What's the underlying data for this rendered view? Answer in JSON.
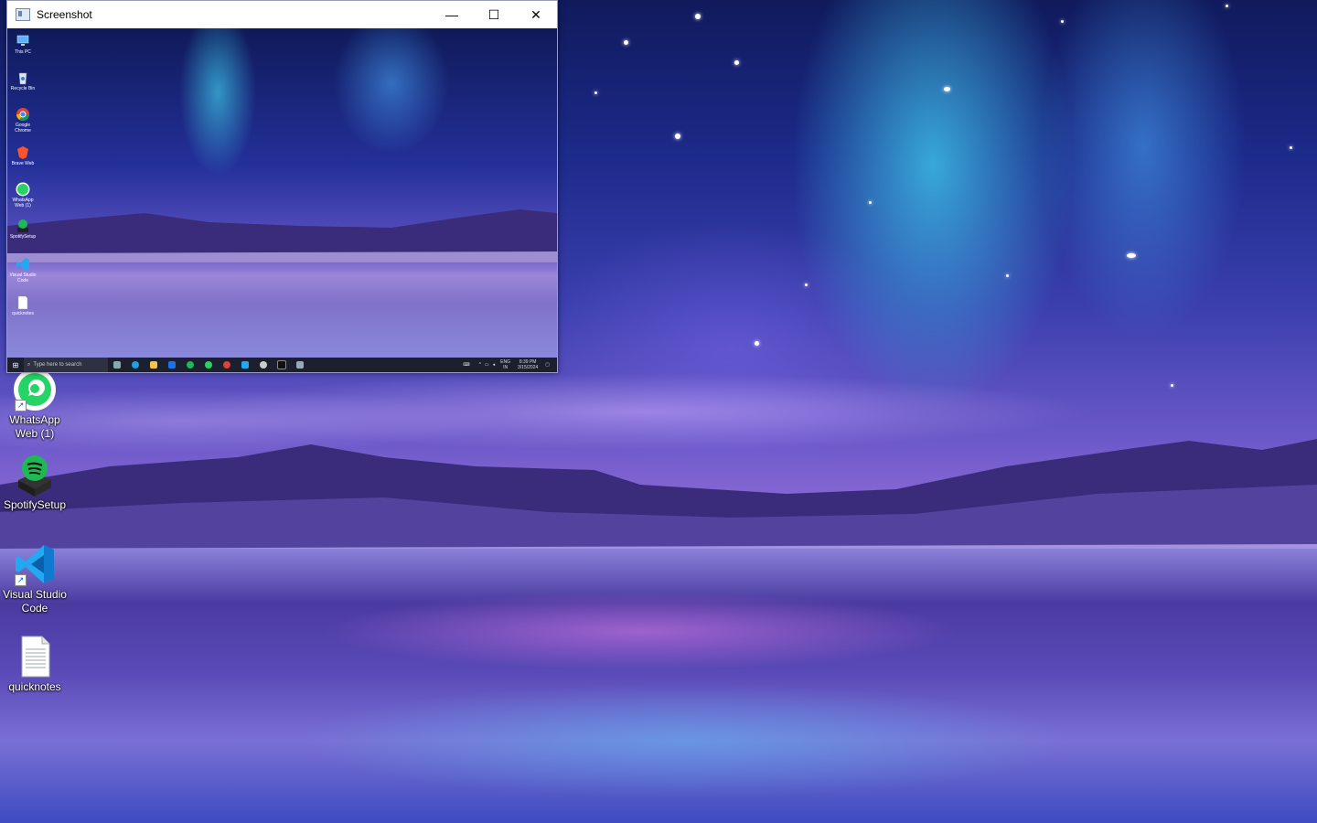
{
  "window": {
    "title": "Screenshot",
    "minimize_glyph": "—",
    "maximize_glyph": "☐",
    "close_glyph": "✕"
  },
  "preview": {
    "icons": [
      {
        "label": "This PC",
        "icon": "this-pc-icon"
      },
      {
        "label": "Recycle Bin",
        "icon": "recycle-bin-icon"
      },
      {
        "label": "Google Chrome",
        "icon": "chrome-icon"
      },
      {
        "label": "Brave Web",
        "icon": "brave-icon"
      },
      {
        "label": "WhatsApp Web (1)",
        "icon": "whatsapp-icon"
      },
      {
        "label": "SpotifySetup",
        "icon": "spotify-icon"
      },
      {
        "label": "Visual Studio Code",
        "icon": "vscode-icon"
      },
      {
        "label": "quicknotes",
        "icon": "text-file-icon"
      }
    ],
    "taskbar": {
      "search_placeholder": "Type here to search",
      "language": "ENG",
      "region": "IN",
      "time": "8:39 PM",
      "date": "3/15/2024"
    }
  },
  "desktop": {
    "icons": [
      {
        "label": "WhatsApp Web (1)",
        "icon": "whatsapp-icon"
      },
      {
        "label": "SpotifySetup",
        "icon": "spotify-icon"
      },
      {
        "label": "Visual Studio Code",
        "icon": "vscode-icon"
      },
      {
        "label": "quicknotes",
        "icon": "text-file-icon"
      }
    ]
  },
  "colors": {
    "whatsapp": "#25d366",
    "spotify": "#1db954",
    "vscode": "#23a9f2",
    "taskbar": "#1c1f2e"
  }
}
